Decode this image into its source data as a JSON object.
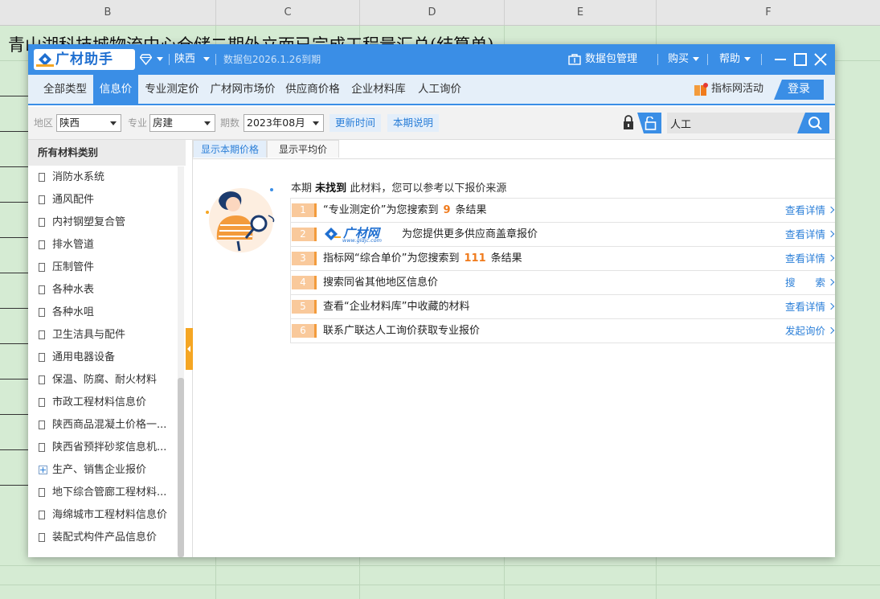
{
  "sheet": {
    "columns": [
      "B",
      "C",
      "D",
      "E",
      "F"
    ],
    "title": "青山湖科技城物流中心仓储二期外立面已完成工程量汇总(结算单)"
  },
  "titlebar": {
    "app_name": "广材助手",
    "region": "陕西",
    "package_expiry": "数据包2026.1.26到期",
    "data_manage": "数据包管理",
    "purchase": "购买",
    "help": "帮助"
  },
  "nav": {
    "tabs": [
      "全部类型",
      "信息价",
      "专业测定价",
      "广材网市场价",
      "供应商价格",
      "企业材料库",
      "人工询价"
    ],
    "active_tab": "信息价",
    "promo": "指标网活动",
    "login": "登录"
  },
  "filters": {
    "region_label": "地区",
    "region_value": "陕西",
    "specialty_label": "专业",
    "specialty_value": "房建",
    "period_label": "期数",
    "period_value": "2023年08月",
    "update_time": "更新时间",
    "period_note": "本期说明",
    "search_value": "人工"
  },
  "sidebar": {
    "heading": "所有材料类别",
    "items": [
      {
        "label": "消防水系统",
        "type": "doc"
      },
      {
        "label": "通风配件",
        "type": "doc"
      },
      {
        "label": "内衬钢塑复合管",
        "type": "doc"
      },
      {
        "label": "排水管道",
        "type": "doc"
      },
      {
        "label": "压制管件",
        "type": "doc"
      },
      {
        "label": "各种水表",
        "type": "doc"
      },
      {
        "label": "各种水咀",
        "type": "doc"
      },
      {
        "label": "卫生洁具与配件",
        "type": "doc"
      },
      {
        "label": "通用电器设备",
        "type": "doc"
      },
      {
        "label": "保温、防腐、耐火材料",
        "type": "doc"
      },
      {
        "label": "市政工程材料信息价",
        "type": "doc"
      },
      {
        "label": "陕西商品混凝土价格一...",
        "type": "doc"
      },
      {
        "label": "陕西省预拌砂浆信息机...",
        "type": "doc"
      },
      {
        "label": "生产、销售企业报价",
        "type": "folder"
      },
      {
        "label": "地下综合管廊工程材料...",
        "type": "doc"
      },
      {
        "label": "海绵城市工程材料信息价",
        "type": "doc"
      },
      {
        "label": "装配式构件产品信息价",
        "type": "doc"
      }
    ]
  },
  "content": {
    "sub_tabs": [
      "显示本期价格",
      "显示平均价"
    ],
    "intro_prefix": "本期",
    "intro_bold": "未找到",
    "intro_suffix": "此材料，您可以参考以下报价来源",
    "results": [
      {
        "num": "1",
        "before": "“专业测定价”为您搜索到",
        "count": "9",
        "after": "条结果",
        "link": "查看详情"
      },
      {
        "num": "2",
        "logo_text": "广材网",
        "logo_url": "www.gldjc.com",
        "after": "为您提供更多供应商盖章报价",
        "link": "查看详情"
      },
      {
        "num": "3",
        "before": "指标网“综合单价”为您搜索到",
        "count": "111",
        "after": "条结果",
        "link": "查看详情"
      },
      {
        "num": "4",
        "before": "搜索同省其他地区信息价",
        "link": "搜　　索"
      },
      {
        "num": "5",
        "before": "查看“企业材料库”中收藏的材料",
        "link": "查看详情"
      },
      {
        "num": "6",
        "before": "联系广联达人工询价获取专业报价",
        "link": "发起询价"
      }
    ]
  },
  "colors": {
    "brand_blue": "#3a8ee6",
    "accent_orange": "#f07b1d",
    "sheet_green": "#d5ebd3"
  }
}
